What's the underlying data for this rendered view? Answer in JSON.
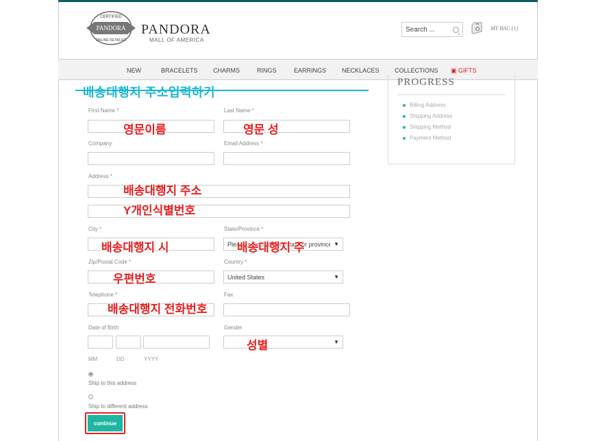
{
  "header": {
    "badge_top": "CERTIFIED",
    "badge_middle": "PANDORA",
    "badge_bottom": "ONLINE RETAILER",
    "brand": "PANDORA",
    "brand_sub": "MALL OF AMERICA",
    "search_placeholder": "Search ...",
    "bag_label": "MY BAG (1)"
  },
  "nav": {
    "items": [
      "NEW",
      "BRACELETS",
      "CHARMS",
      "RINGS",
      "EARRINGS",
      "NECKLACES",
      "COLLECTIONS"
    ],
    "gifts_label": "GIFTS"
  },
  "annotation_heading": "배송대행지 주소입력하기",
  "progress": {
    "title": "PROGRESS",
    "steps": [
      "Billing Address",
      "Shipping Address",
      "Shipping Method",
      "Payment Method"
    ]
  },
  "form": {
    "first_name_label": "First Name",
    "last_name_label": "Last Name",
    "company_label": "Company",
    "email_label": "Email Address",
    "address_label": "Address",
    "city_label": "City",
    "state_label": "State/Province",
    "state_value": "Please select region, state or province",
    "zip_label": "Zip/Postal Code",
    "country_label": "Country",
    "country_value": "United States",
    "telephone_label": "Telephone",
    "fax_label": "Fax",
    "dob_label": "Date of Birth",
    "gender_label": "Gender",
    "dob_mm": "MM",
    "dob_dd": "DD",
    "dob_yyyy": "YYYY",
    "required_mark": "*",
    "ship_same_label": "Ship to this address",
    "ship_diff_label": "Ship to different address",
    "continue_label": "continue"
  },
  "annotations": {
    "first_name": "영문이름",
    "last_name": "영문 성",
    "address1": "배송대행지 주소",
    "address2": "Y개인식별번호",
    "city": "배송대행지 시",
    "state": "배송대행지 주",
    "zip": "우편번호",
    "telephone": "배송대행지 전화번호",
    "gender": "성별"
  },
  "colors": {
    "accent": "#1fb5a3",
    "annotation_red": "#e52020",
    "annotation_cyan": "#1ab7d4",
    "gifts_red": "#d62020"
  }
}
